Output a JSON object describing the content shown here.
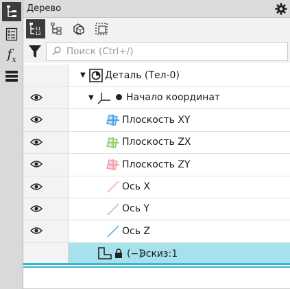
{
  "panel": {
    "title": "Дерево"
  },
  "search": {
    "placeholder": "Поиск (Ctrl+/)"
  },
  "strip": {
    "icons": [
      "tree-icon",
      "checklist-icon",
      "fx-icon",
      "layers-icon"
    ],
    "fx_label": "f",
    "fx_sub": "x"
  },
  "toolbar": {
    "icons": [
      "tree-structure-icon",
      "tree-hierarchy-icon",
      "parts-icon",
      "selection-icon"
    ]
  },
  "tree": {
    "rows": [
      {
        "label": "Деталь (Тел-0)",
        "icon": "part-icon",
        "visible_toggle": false
      },
      {
        "label": "Начало координат",
        "icon": "origin-icon",
        "visible_toggle": true
      },
      {
        "label": "Плоскость XY",
        "icon": "plane-icon",
        "color": "#4aa3df",
        "visible_toggle": true
      },
      {
        "label": "Плоскость ZX",
        "icon": "plane-icon",
        "color": "#8fd07a",
        "visible_toggle": true
      },
      {
        "label": "Плоскость ZY",
        "icon": "plane-icon",
        "color": "#f2a0ac",
        "visible_toggle": true
      },
      {
        "label": "Ось X",
        "icon": "axis-icon",
        "color": "#f2a0ac",
        "visible_toggle": true
      },
      {
        "label": "Ось Y",
        "icon": "axis-icon",
        "color": "#8fd07a",
        "visible_toggle": true
      },
      {
        "label": "Ось Z",
        "icon": "axis-icon",
        "color": "#4aa3df",
        "visible_toggle": true
      },
      {
        "label": "Эскиз:1",
        "prefix": "(−)",
        "icon": "sketch-icon",
        "locked": true,
        "selected": true,
        "visible_toggle": false
      }
    ]
  },
  "colors": {
    "selection": "#a6e1ee",
    "selection_bar": "#36b6cf",
    "active_button": "#3c3c3c"
  }
}
